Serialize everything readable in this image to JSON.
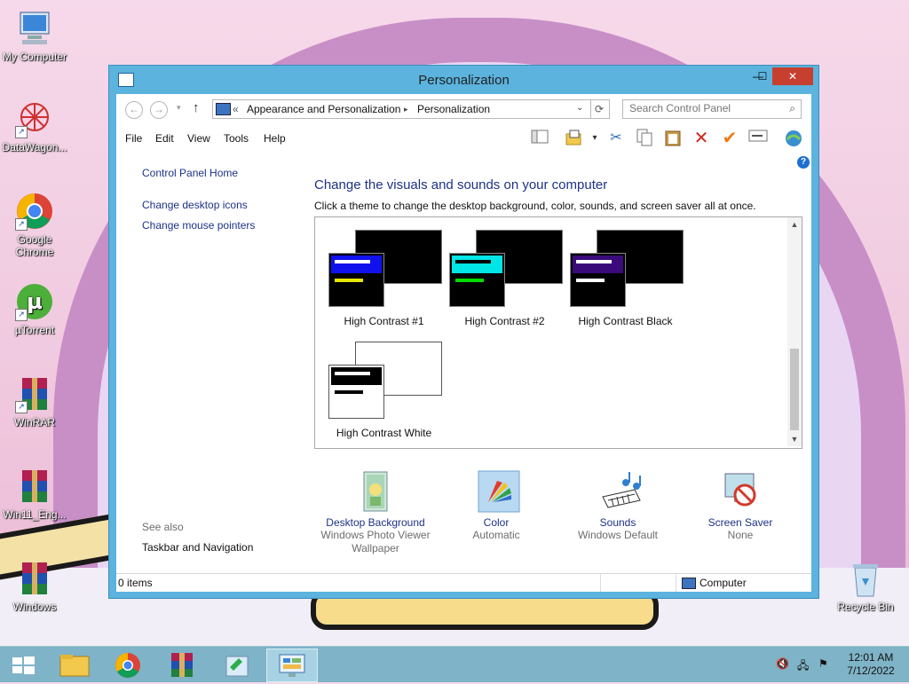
{
  "desktop": {
    "icons": [
      {
        "label": "My Computer"
      },
      {
        "label": "DataWagon..."
      },
      {
        "label": "Google Chrome"
      },
      {
        "label": "µTorrent"
      },
      {
        "label": "WinRAR"
      },
      {
        "label": "Win11_Eng..."
      },
      {
        "label": "Windows"
      },
      {
        "label": "Recycle Bin"
      }
    ]
  },
  "window": {
    "title": "Personalization",
    "controls": {
      "minimize": "—",
      "maximize": "☐",
      "close": "✕"
    },
    "address": {
      "prefix": "«",
      "crumbs": [
        "Appearance and Personalization",
        "Personalization"
      ],
      "separator": "▸"
    },
    "search": {
      "placeholder": "Search Control Panel"
    },
    "menu": [
      "File",
      "Edit",
      "View",
      "Tools",
      "Help"
    ],
    "left_panel": {
      "links": [
        "Control Panel Home",
        "Change desktop icons",
        "Change mouse pointers"
      ],
      "see_also_label": "See also",
      "see_also_links": [
        "Taskbar and Navigation"
      ]
    },
    "main": {
      "heading": "Change the visuals and sounds on your computer",
      "subtitle": "Click a theme to change the desktop background, color, sounds, and screen saver all at once.",
      "themes": [
        {
          "name": "High Contrast #1",
          "back": "#000000",
          "front": "#000000",
          "bar": "#1111ee",
          "line1": "#ffffff",
          "line2": "#e6e600"
        },
        {
          "name": "High Contrast #2",
          "back": "#000000",
          "front": "#000000",
          "bar": "#00e6e6",
          "line1": "#000000",
          "line2": "#00dd00"
        },
        {
          "name": "High Contrast Black",
          "back": "#000000",
          "front": "#000000",
          "bar": "#3a0a7a",
          "line1": "#ffffff",
          "line2": "#ffffff"
        },
        {
          "name": "High Contrast White",
          "back": "#ffffff",
          "front": "#ffffff",
          "bar": "#000000",
          "line1": "#ffffff",
          "line2": "#000000"
        }
      ],
      "settings": [
        {
          "title": "Desktop Background",
          "value": "Windows Photo Viewer Wallpaper"
        },
        {
          "title": "Color",
          "value": "Automatic"
        },
        {
          "title": "Sounds",
          "value": "Windows Default"
        },
        {
          "title": "Screen Saver",
          "value": "None"
        }
      ]
    },
    "status": {
      "items": "0 items",
      "location": "Computer"
    }
  },
  "taskbar": {
    "clock_time": "12:01 AM",
    "clock_date": "7/12/2022"
  }
}
